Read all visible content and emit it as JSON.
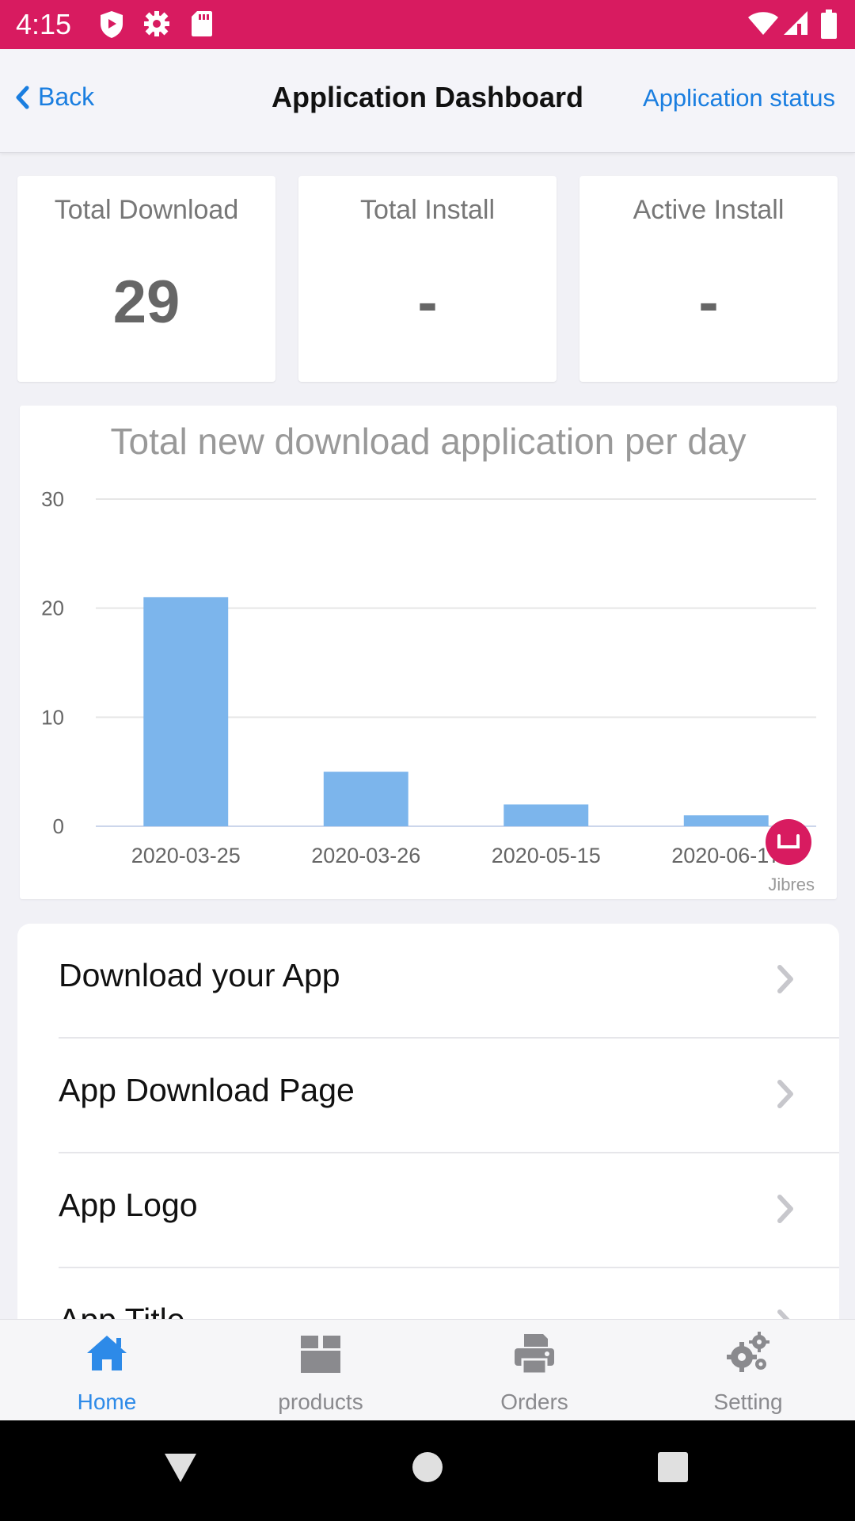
{
  "status_bar": {
    "time": "4:15",
    "icons": [
      "shield-icon",
      "gear-icon",
      "sd-card-icon",
      "wifi-icon",
      "signal-icon",
      "battery-icon"
    ]
  },
  "nav": {
    "back_label": "Back",
    "title": "Application Dashboard",
    "action_label": "Application status"
  },
  "stats": [
    {
      "label": "Total Download",
      "value": "29"
    },
    {
      "label": "Total Install",
      "value": "-"
    },
    {
      "label": "Active Install",
      "value": "-"
    }
  ],
  "chart_data": {
    "type": "bar",
    "title": "Total new download application per day",
    "categories": [
      "2020-03-25",
      "2020-03-26",
      "2020-05-15",
      "2020-06-17"
    ],
    "values": [
      21,
      5,
      2,
      1
    ],
    "ylim": [
      0,
      30
    ],
    "yticks": [
      0,
      10,
      20,
      30
    ],
    "grid": true,
    "bar_color": "#7cb5ec",
    "credit": "Jibres"
  },
  "list": [
    {
      "label": "Download your App"
    },
    {
      "label": "App Download Page"
    },
    {
      "label": "App Logo"
    },
    {
      "label": "App Title"
    }
  ],
  "tabs": [
    {
      "label": "products",
      "icon": "box-icon"
    },
    {
      "label": "Orders",
      "icon": "printer-icon"
    },
    {
      "label": "Setting",
      "icon": "gears-icon"
    }
  ],
  "active_tab": {
    "label": "Home",
    "icon": "home-icon"
  },
  "colors": {
    "brand": "#d81b60",
    "link": "#1a7ee0",
    "active_tab": "#2d8ae8"
  }
}
